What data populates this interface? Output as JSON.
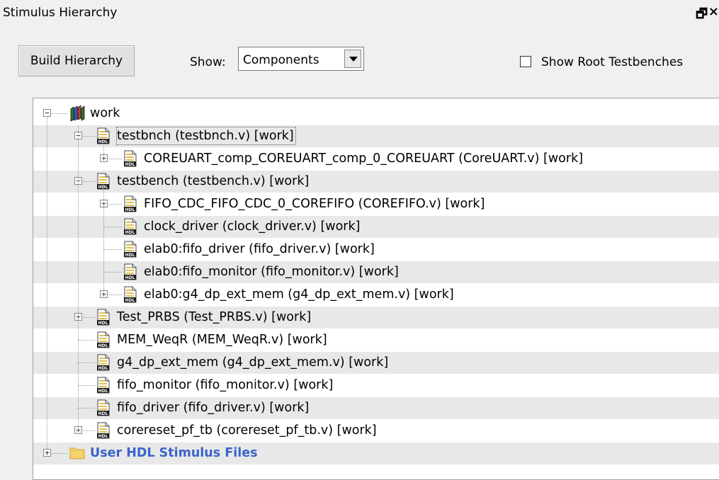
{
  "window": {
    "title": "Stimulus Hierarchy"
  },
  "toolbar": {
    "build_label": "Build Hierarchy",
    "show_label": "Show:",
    "show_value": "Components",
    "root_testbenches_label": "Show Root Testbenches",
    "root_testbenches_checked": false
  },
  "tree": {
    "rows": [
      {
        "label": "work",
        "icon": "library-icon",
        "depth": 0,
        "expander": "minus"
      },
      {
        "label": "testbnch (testbnch.v) [work]",
        "icon": "hdl-file-icon",
        "depth": 1,
        "expander": "minus",
        "selected": true
      },
      {
        "label": "COREUART_comp_COREUART_comp_0_COREUART (CoreUART.v) [work]",
        "icon": "hdl-file-icon",
        "depth": 2,
        "expander": "plus"
      },
      {
        "label": "testbench (testbench.v) [work]",
        "icon": "hdl-file-icon",
        "depth": 1,
        "expander": "minus"
      },
      {
        "label": "FIFO_CDC_FIFO_CDC_0_COREFIFO (COREFIFO.v) [work]",
        "icon": "hdl-file-icon",
        "depth": 2,
        "expander": "plus"
      },
      {
        "label": "clock_driver (clock_driver.v) [work]",
        "icon": "hdl-file-icon",
        "depth": 2,
        "expander": "none"
      },
      {
        "label": "elab0:fifo_driver (fifo_driver.v) [work]",
        "icon": "hdl-file-icon",
        "depth": 2,
        "expander": "none"
      },
      {
        "label": "elab0:fifo_monitor (fifo_monitor.v) [work]",
        "icon": "hdl-file-icon",
        "depth": 2,
        "expander": "none"
      },
      {
        "label": "elab0:g4_dp_ext_mem (g4_dp_ext_mem.v) [work]",
        "icon": "hdl-file-icon",
        "depth": 2,
        "expander": "plus"
      },
      {
        "label": "Test_PRBS (Test_PRBS.v) [work]",
        "icon": "hdl-file-icon",
        "depth": 1,
        "expander": "plus"
      },
      {
        "label": "MEM_WeqR (MEM_WeqR.v) [work]",
        "icon": "hdl-file-icon",
        "depth": 1,
        "expander": "none"
      },
      {
        "label": "g4_dp_ext_mem (g4_dp_ext_mem.v) [work]",
        "icon": "hdl-file-icon",
        "depth": 1,
        "expander": "none"
      },
      {
        "label": "fifo_monitor (fifo_monitor.v) [work]",
        "icon": "hdl-file-icon",
        "depth": 1,
        "expander": "none"
      },
      {
        "label": "fifo_driver (fifo_driver.v) [work]",
        "icon": "hdl-file-icon",
        "depth": 1,
        "expander": "none"
      },
      {
        "label": "corereset_pf_tb (corereset_pf_tb.v) [work]",
        "icon": "hdl-file-icon",
        "depth": 1,
        "expander": "plus"
      },
      {
        "label": "User HDL Stimulus Files",
        "icon": "folder-icon",
        "depth": 0,
        "expander": "plus"
      }
    ]
  },
  "icon_labels": {
    "hdl": "HDL"
  },
  "colors": {
    "folder_label": "#3b64c9",
    "alt_row": "#e8e8e8",
    "panel_bg": "#f0f0f0"
  }
}
